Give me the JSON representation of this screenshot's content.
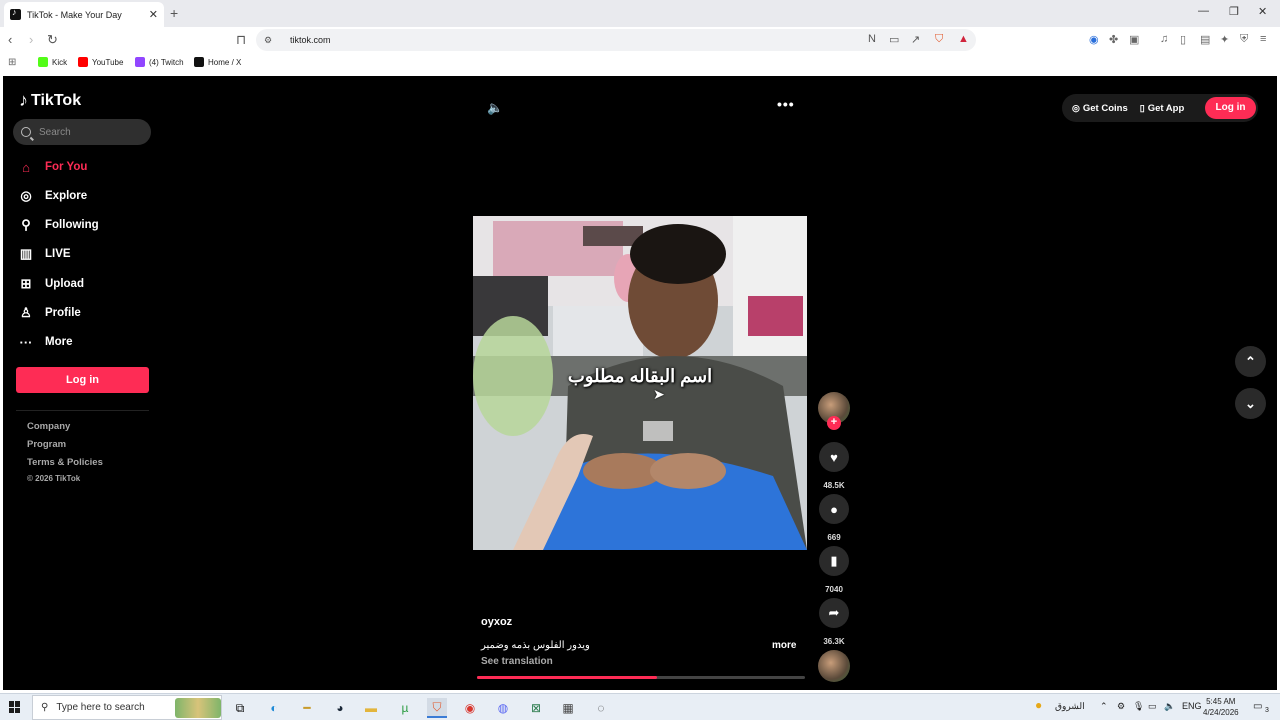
{
  "browser": {
    "tab_title": "TikTok - Make Your Day",
    "tab_close": "✕",
    "new_tab": "+",
    "url": "tiktok.com",
    "window_controls": {
      "minimize": "—",
      "restore": "❐",
      "close": "✕"
    },
    "bookmarks": [
      {
        "label": "Kick",
        "color": "#53fc18"
      },
      {
        "label": "YouTube",
        "color": "#ff0000"
      },
      {
        "label": "(4) Twitch",
        "color": "#9146ff"
      },
      {
        "label": "Home / X",
        "color": "#111111"
      }
    ]
  },
  "sidebar": {
    "logo": "TikTok",
    "search_placeholder": "Search",
    "nav": [
      {
        "label": "For You",
        "icon": "home-icon",
        "active": true
      },
      {
        "label": "Explore",
        "icon": "compass-icon"
      },
      {
        "label": "Following",
        "icon": "following-icon"
      },
      {
        "label": "LIVE",
        "icon": "live-icon"
      },
      {
        "label": "Upload",
        "icon": "upload-icon"
      },
      {
        "label": "Profile",
        "icon": "profile-icon"
      },
      {
        "label": "More",
        "icon": "more-icon"
      }
    ],
    "login_label": "Log in",
    "footer_links": [
      "Company",
      "Program",
      "Terms & Policies"
    ],
    "copyright": "© 2026 TikTok"
  },
  "header": {
    "get_coins": "Get Coins",
    "get_app": "Get App",
    "login_label": "Log in",
    "more_label": "•••"
  },
  "video": {
    "overlay_text": "اسم البقاله مطلوب",
    "username": "oyxoz",
    "description": "ويدور الفلوس بذمه وضمير",
    "more_label": "more",
    "see_translation": "See translation",
    "progress": 0.55
  },
  "actions": {
    "follow": "+",
    "likes": "48.5K",
    "comments": "669",
    "saves": "7040",
    "shares": "36.3K"
  },
  "taskbar": {
    "search_placeholder": "Type here to search",
    "weather_label": "الشروق",
    "language": "ENG",
    "time": "5:45 AM",
    "date": "4/24/2026",
    "notifications": "3"
  },
  "colors": {
    "accent": "#fe2c55",
    "page_bg": "#000000"
  }
}
